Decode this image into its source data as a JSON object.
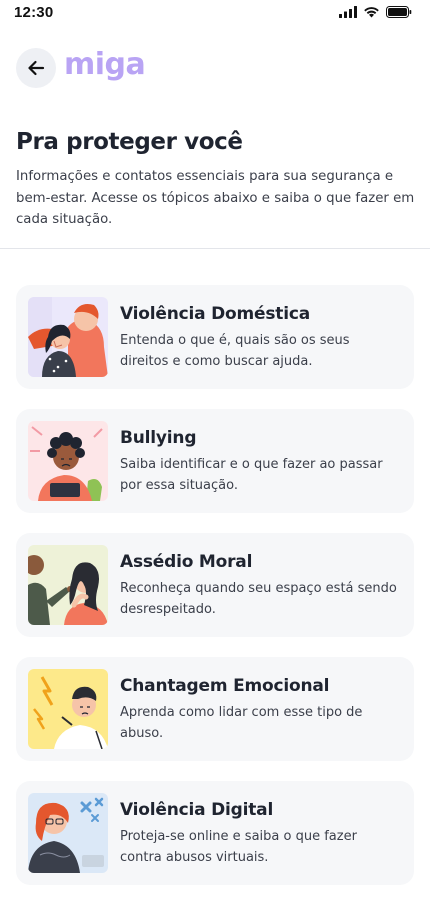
{
  "status_bar": {
    "time": "12:30"
  },
  "header": {
    "back_icon": "arrow-left-icon",
    "logo_text": "miga",
    "logo_color": "#b9a4f4"
  },
  "page": {
    "title": "Pra proteger você",
    "subtitle": "Informações e contatos essenciais para sua segurança e bem-estar. Acesse os tópicos abaixo e saiba o que fazer em cada situação."
  },
  "topics": [
    {
      "title": "Violência Doméstica",
      "description": "Entenda o que é, quais são os seus direitos e como buscar ajuda.",
      "thumb_bg": "#ebe8fb"
    },
    {
      "title": "Bullying",
      "description": "Saiba identificar e o que fazer ao passar por essa situação.",
      "thumb_bg": "#fde6e8"
    },
    {
      "title": "Assédio Moral",
      "description": "Reconheça quando seu espaço está sendo desrespeitado.",
      "thumb_bg": "#eef2d8"
    },
    {
      "title": "Chantagem Emocional",
      "description": "Aprenda como lidar com esse tipo de abuso.",
      "thumb_bg": "#fde98a"
    },
    {
      "title": "Violência Digital",
      "description": "Proteja-se online e saiba o que fazer contra abusos virtuais.",
      "thumb_bg": "#dbe8f7"
    }
  ]
}
